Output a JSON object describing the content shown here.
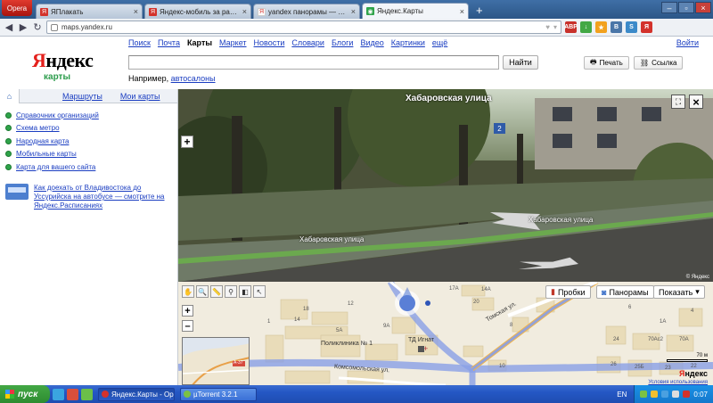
{
  "browser": {
    "menu_label": "Opera",
    "tabs": [
      {
        "label": "ЯПлакать",
        "favicon_color": "#d3322b",
        "favicon_glyph": "Я"
      },
      {
        "label": "Яндекс-мобиль за работой",
        "favicon_color": "#d3322b",
        "favicon_glyph": "Я"
      },
      {
        "label": "yandex панорамы — Яндекс",
        "favicon_color": "#ffffff",
        "favicon_glyph": "Я"
      },
      {
        "label": "Яндекс.Карты",
        "favicon_color": "#2fa34a",
        "favicon_glyph": "◉",
        "active": true
      }
    ],
    "new_tab_label": "+",
    "url": "maps.yandex.ru",
    "extensions": [
      {
        "label": "ABP",
        "color": "#c8312b"
      },
      {
        "label": "↓",
        "color": "#43a845"
      },
      {
        "label": "★",
        "color": "#f2a11d"
      },
      {
        "label": "В",
        "color": "#4a76a8"
      },
      {
        "label": "S",
        "color": "#3c8ac9"
      },
      {
        "label": "Я",
        "color": "#d3322b"
      }
    ]
  },
  "header": {
    "logo_main": "ндекс",
    "logo_first": "Я",
    "logo_sub": "карты",
    "services": [
      "Поиск",
      "Почта",
      "Карты",
      "Маркет",
      "Новости",
      "Словари",
      "Блоги",
      "Видео",
      "Картинки",
      "ещё"
    ],
    "current_service": "Карты",
    "login": "Войти",
    "search_value": "",
    "search_button": "Найти",
    "example_prefix": "Например,",
    "example_link": "автосалоны",
    "print_label": "Печать",
    "link_label": "Ссылка"
  },
  "sidebar": {
    "tabs": [
      "Маршруты",
      "Мои карты"
    ],
    "links": [
      "Справочник организаций",
      "Схема метро",
      "Народная карта",
      "Мобильные карты",
      "Карта для вашего сайта"
    ],
    "promo": "Как доехать от Владивостока до Уссурийска на автобусе — смотрите на Яндекс.Расписаниях"
  },
  "panorama": {
    "title": "Хабаровская улица",
    "street_label_1": "Хабаровская улица",
    "street_label_2": "Хабаровская улица",
    "house_number": "2",
    "copyright": "© Яндекс"
  },
  "map": {
    "layers": [
      "Пробки",
      "Панорамы",
      "Показать"
    ],
    "labels": {
      "b18": "18",
      "b5a": "5А",
      "b1": "1",
      "b14": "14",
      "b9a": "9А",
      "b12": "12",
      "b17a": "17А",
      "b14a": "14А",
      "b20": "20",
      "b8": "8",
      "b10": "10",
      "b26": "26",
      "b6": "6",
      "b4": "4",
      "b1a": "1А",
      "b70ac2": "70Ас2",
      "b70a": "70А",
      "b25b": "25Б",
      "b24": "24",
      "b23": "23",
      "b22": "22"
    },
    "poi_clinic": "Поликлиника № 1",
    "poi_shop": "ТД Игнат",
    "street_tomsk": "Томская ул.",
    "street_komsomol": "Комсомольская ул.",
    "minimap_road": "А-37",
    "scale": "70 м",
    "logo_main": "ндекс",
    "logo_first": "Я",
    "terms": "Условия использования"
  },
  "taskbar": {
    "start": "пуск",
    "tasks": [
      "Яндекс.Карты - Opera",
      "µTorrent 3.2.1"
    ],
    "lang": "EN",
    "clock": "0:07"
  }
}
